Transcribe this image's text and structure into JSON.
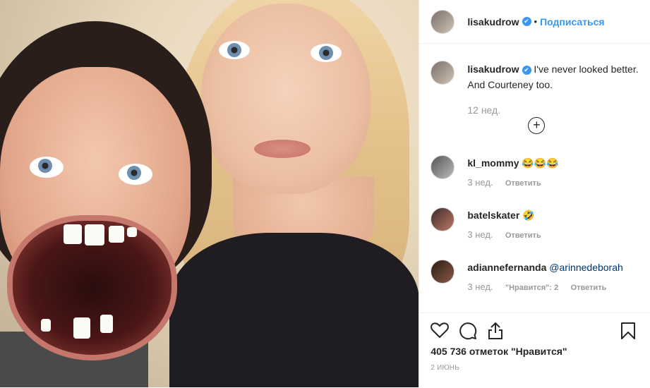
{
  "header": {
    "username": "lisakudrow",
    "verified_glyph": "✔",
    "separator": "•",
    "follow_label": "Подписаться"
  },
  "caption": {
    "username": "lisakudrow",
    "text_line1": "I've never looked better.",
    "text_line2": "And Courteney too.",
    "time": "12 нед."
  },
  "load_more_glyph": "+",
  "comments": [
    {
      "username": "kl_mommy",
      "text": "😂😂😂",
      "time": "3 нед.",
      "reply_label": "Ответить"
    },
    {
      "username": "batelskater",
      "text": "🤣",
      "time": "3 нед.",
      "reply_label": "Ответить"
    },
    {
      "username": "adiannefernanda",
      "text": "@arinnedeborah",
      "time": "3 нед.",
      "likes_label": "\"Нравится\": 2",
      "reply_label": "Ответить"
    }
  ],
  "actions": {
    "icons": [
      "heart-icon",
      "comment-icon",
      "share-icon",
      "bookmark-icon"
    ],
    "likes_text": "405 736 отметок \"Нравится\"",
    "date": "2 ИЮНЬ"
  }
}
